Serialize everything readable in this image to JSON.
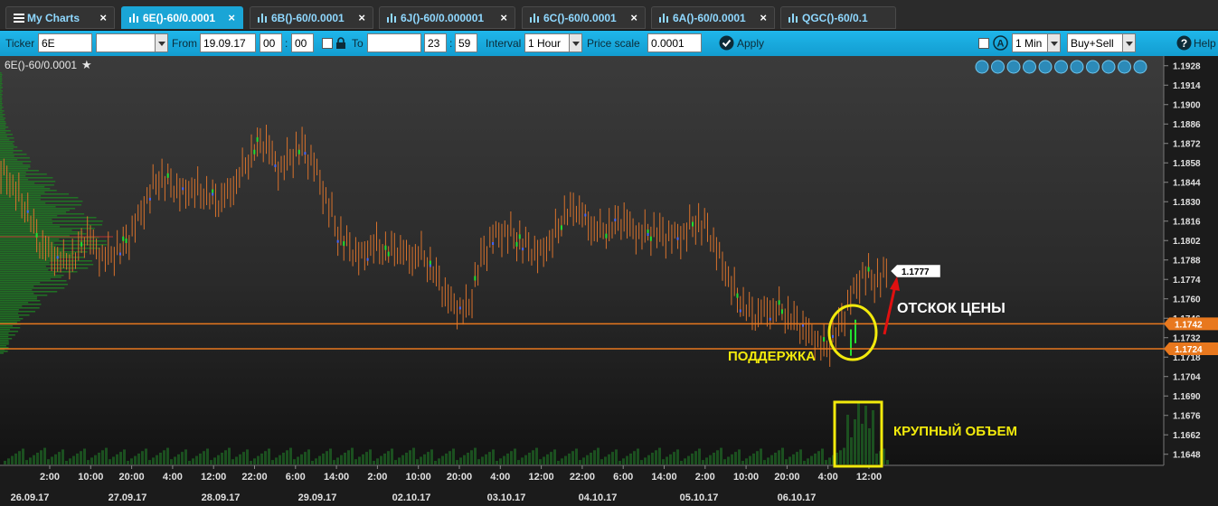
{
  "tabs": [
    {
      "label": "My Charts",
      "active": false
    },
    {
      "label": "6E()-60/0.0001",
      "active": true
    },
    {
      "label": "6B()-60/0.0001",
      "active": false
    },
    {
      "label": "6J()-60/0.000001",
      "active": false
    },
    {
      "label": "6C()-60/0.0001",
      "active": false
    },
    {
      "label": "6A()-60/0.0001",
      "active": false
    },
    {
      "label": "QGC()-60/0.1",
      "active": false
    }
  ],
  "toolbar": {
    "ticker_label": "Ticker",
    "ticker_value": "6E",
    "from_label": "From",
    "from_date": "19.09.17",
    "from_hour": "00",
    "from_minute": "00",
    "to_label": "To",
    "to_hour": "23",
    "to_minute": "59",
    "interval_label": "Interval",
    "interval_value": "1 Hour",
    "price_scale_label": "Price scale",
    "price_scale_value": "0.0001",
    "apply_label": "Apply",
    "timeframe_value": "1 Min",
    "side_value": "Buy+Sell",
    "help_label": "Help"
  },
  "chart": {
    "title": "6E()-60/0.0001",
    "current_price_tag": "1.1777",
    "level_tags": [
      "1.1742",
      "1.1724"
    ],
    "annotations": {
      "bounce": "ОТСКОК ЦЕНЫ",
      "support": "ПОДДЕРЖКА",
      "large_volume": "КРУПНЫЙ ОБЪЕМ"
    },
    "price_ticks": [
      "1.1928",
      "1.1914",
      "1.1900",
      "1.1886",
      "1.1872",
      "1.1858",
      "1.1844",
      "1.1830",
      "1.1816",
      "1.1802",
      "1.1788",
      "1.1774",
      "1.1760",
      "1.1746",
      "1.1732",
      "1.1718",
      "1.1704",
      "1.1690",
      "1.1676",
      "1.1662",
      "1.1648"
    ],
    "time_ticks": [
      "2:00",
      "10:00",
      "20:00",
      "4:00",
      "12:00",
      "22:00",
      "6:00",
      "14:00",
      "2:00",
      "10:00",
      "20:00",
      "4:00",
      "12:00",
      "22:00",
      "6:00",
      "14:00",
      "2:00",
      "10:00",
      "20:00",
      "4:00",
      "12:00"
    ],
    "date_ticks": [
      "26.09.17",
      "27.09.17",
      "28.09.17",
      "29.09.17",
      "02.10.17",
      "03.10.17",
      "04.10.17",
      "05.10.17",
      "06.10.17"
    ]
  },
  "chart_data": {
    "type": "bar",
    "instrument": "6E()-60/0.0001",
    "ylim": [
      1.164,
      1.1935
    ],
    "support_levels": [
      1.1742,
      1.1724
    ],
    "last_price": 1.1777,
    "series": [
      {
        "name": "price_close",
        "values": [
          1.185,
          1.1838,
          1.1822,
          1.18,
          1.1792,
          1.1786,
          1.179,
          1.1808,
          1.179,
          1.1792,
          1.1798,
          1.1812,
          1.1832,
          1.1848,
          1.1842,
          1.1836,
          1.184,
          1.1834,
          1.183,
          1.1838,
          1.1852,
          1.1868,
          1.1874,
          1.1852,
          1.1862,
          1.187,
          1.1856,
          1.1832,
          1.1808,
          1.1796,
          1.179,
          1.18,
          1.1794,
          1.1796,
          1.179,
          1.1792,
          1.178,
          1.1764,
          1.1752,
          1.1754,
          1.179,
          1.1804,
          1.1808,
          1.1804,
          1.1796,
          1.1792,
          1.1804,
          1.182,
          1.1826,
          1.1814,
          1.1808,
          1.1812,
          1.1818,
          1.1806,
          1.1808,
          1.1808,
          1.1804,
          1.1806,
          1.1816,
          1.181,
          1.179,
          1.177,
          1.1754,
          1.1748,
          1.1752,
          1.1752,
          1.1746,
          1.174,
          1.173,
          1.1724,
          1.174,
          1.176,
          1.1778,
          1.1774,
          1.1777
        ]
      }
    ]
  }
}
